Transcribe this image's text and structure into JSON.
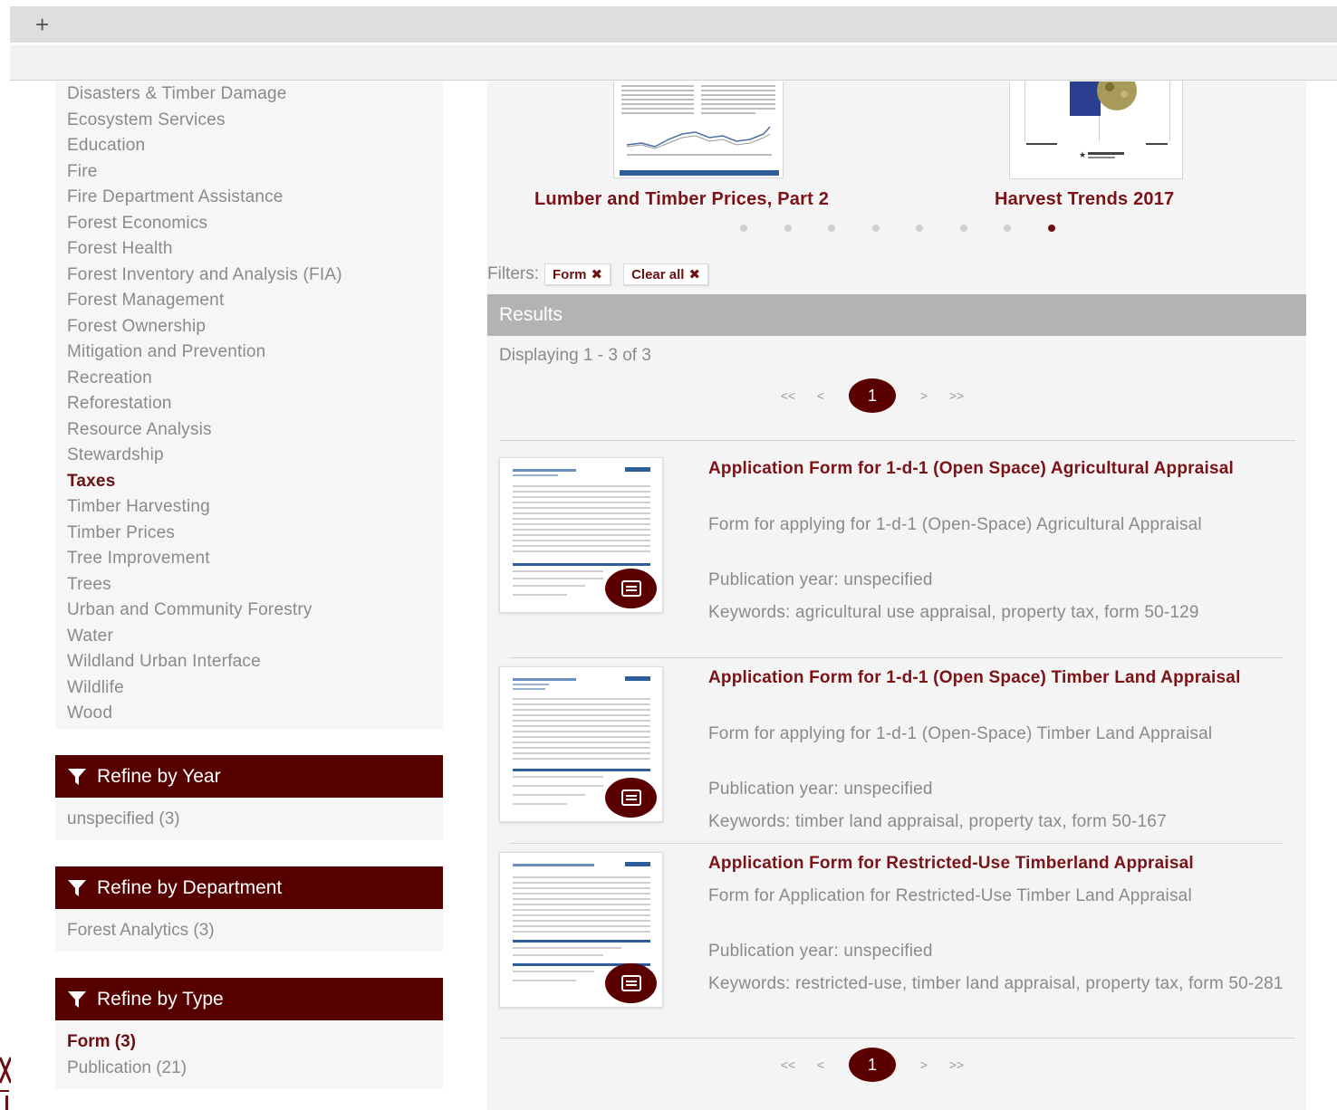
{
  "browser": {
    "new_tab_label": "+"
  },
  "sidebar": {
    "topics": [
      {
        "label": "Disasters & Timber Damage",
        "active": false
      },
      {
        "label": "Ecosystem Services",
        "active": false
      },
      {
        "label": "Education",
        "active": false
      },
      {
        "label": "Fire",
        "active": false
      },
      {
        "label": "Fire Department Assistance",
        "active": false
      },
      {
        "label": "Forest Economics",
        "active": false
      },
      {
        "label": "Forest Health",
        "active": false
      },
      {
        "label": "Forest Inventory and Analysis (FIA)",
        "active": false
      },
      {
        "label": "Forest Management",
        "active": false
      },
      {
        "label": "Forest Ownership",
        "active": false
      },
      {
        "label": "Mitigation and Prevention",
        "active": false
      },
      {
        "label": "Recreation",
        "active": false
      },
      {
        "label": "Reforestation",
        "active": false
      },
      {
        "label": "Resource Analysis",
        "active": false
      },
      {
        "label": "Stewardship",
        "active": false
      },
      {
        "label": "Taxes",
        "active": true
      },
      {
        "label": "Timber Harvesting",
        "active": false
      },
      {
        "label": "Timber Prices",
        "active": false
      },
      {
        "label": "Tree Improvement",
        "active": false
      },
      {
        "label": "Trees",
        "active": false
      },
      {
        "label": "Urban and Community Forestry",
        "active": false
      },
      {
        "label": "Water",
        "active": false
      },
      {
        "label": "Wildland Urban Interface",
        "active": false
      },
      {
        "label": "Wildlife",
        "active": false
      },
      {
        "label": "Wood",
        "active": false
      }
    ],
    "refine_year": {
      "title": "Refine by Year",
      "options": [
        "unspecified (3)"
      ]
    },
    "refine_department": {
      "title": "Refine by Department",
      "options": [
        "Forest Analytics (3)"
      ]
    },
    "refine_type": {
      "title": "Refine by Type",
      "options": [
        "Form (3)",
        "Publication (21)"
      ],
      "active_index": 0
    }
  },
  "carousel": {
    "items": [
      {
        "title": "Lumber and Timber Prices, Part 2"
      },
      {
        "title": "Harvest Trends 2017"
      }
    ],
    "dot_count": 8,
    "active_dot": 7
  },
  "filters": {
    "label": "Filters:",
    "chips": [
      {
        "label": "Form",
        "remove_icon": "✖"
      },
      {
        "label": "Clear all",
        "remove_icon": "✖"
      }
    ]
  },
  "results": {
    "header": "Results",
    "displaying": "Displaying 1 - 3 of 3",
    "pager": {
      "first": "<<",
      "prev": "<",
      "current": "1",
      "next": ">",
      "last": ">>"
    },
    "items": [
      {
        "title": "Application Form for 1-d-1 (Open Space) Agricultural Appraisal",
        "description": "Form for applying for 1-d-1 (Open-Space) Agricultural Appraisal",
        "year": "Publication year: unspecified",
        "keywords": "Keywords: agricultural use appraisal, property tax, form 50-129"
      },
      {
        "title": "Application Form for 1-d-1 (Open Space) Timber Land Appraisal",
        "description": "Form for applying for 1-d-1 (Open-Space) Timber Land Appraisal",
        "year": "Publication year: unspecified",
        "keywords": "Keywords: timber land appraisal, property tax, form 50-167"
      },
      {
        "title": "Application Form for Restricted-Use Timberland Appraisal",
        "description": "Form for Application for Restricted-Use Timber Land Appraisal",
        "year": "Publication year: unspecified",
        "keywords": "Keywords: restricted-use, timber land appraisal, property tax, form 50-281"
      }
    ]
  },
  "colors": {
    "brand": "#560000",
    "link": "#7a1216",
    "text_muted": "#8a8a8a",
    "results_bar": "#b3b3b3"
  }
}
